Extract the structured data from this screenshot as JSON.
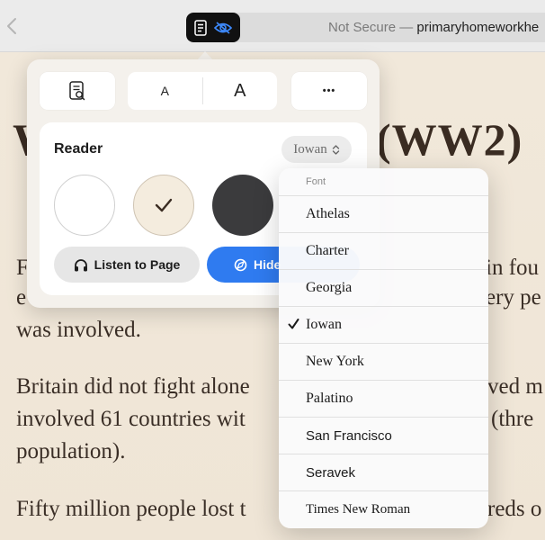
{
  "browser": {
    "url_prefix": "Not Secure — ",
    "url_domain": "primaryhomeworkhe"
  },
  "article": {
    "title_start": "W",
    "title_end": "(WW2)",
    "para1_line1_left": "F",
    "para1_line1_right": "in fou",
    "para1_line2_left": "e",
    "para1_line2_right": "ery pe",
    "para1_line3": "was involved.",
    "para2_line1_left": "Britain did not fight alone",
    "para2_line1_right": "ved m",
    "para2_line2_left": "involved 61 countries wit",
    "para2_line2_right": "(thre",
    "para2_line3": "population).",
    "para3_line1_left": "Fifty million people lost t",
    "para3_line1_right": "reds o"
  },
  "reader_popover": {
    "font_smaller_label": "A",
    "font_larger_label": "A",
    "more_label": "•••",
    "card_title": "Reader",
    "font_selected": "Iowan",
    "themes": [
      {
        "name": "white",
        "color": "#ffffff"
      },
      {
        "name": "sepia",
        "color": "#f4ecde"
      },
      {
        "name": "gray",
        "color": "#3b3b3d"
      }
    ],
    "selected_theme": "sepia",
    "listen_label": "Listen to Page",
    "hide_label": "Hide"
  },
  "font_menu": {
    "header": "Font",
    "items": [
      {
        "label": "Athelas",
        "selected": false
      },
      {
        "label": "Charter",
        "selected": false
      },
      {
        "label": "Georgia",
        "selected": false
      },
      {
        "label": "Iowan",
        "selected": true
      },
      {
        "label": "New York",
        "selected": false
      },
      {
        "label": "Palatino",
        "selected": false
      },
      {
        "label": "San Francisco",
        "selected": false
      },
      {
        "label": "Seravek",
        "selected": false
      },
      {
        "label": "Times New Roman",
        "selected": false
      }
    ]
  },
  "colors": {
    "accent": "#2f7bf0",
    "sepia_background": "#efe5d6",
    "text": "#3a2e26"
  }
}
